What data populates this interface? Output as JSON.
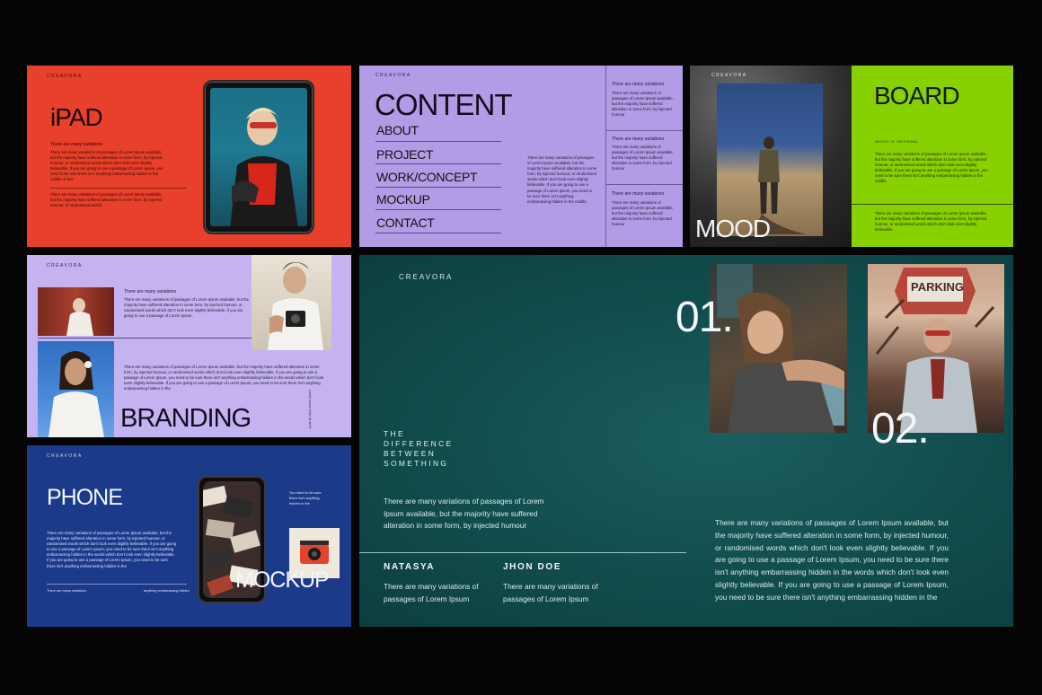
{
  "colors": {
    "orange": "#e8402a",
    "lavender": "#b39ce6",
    "lime": "#88d100",
    "navy": "#1c3a8a",
    "teal": "#0f4c4d",
    "dark_bg": "#050506"
  },
  "slide_ipad": {
    "brand": "CREAVORA",
    "title": "iPAD",
    "subhead": "There are many variations",
    "body1": "There are many variations of passages of Lorem Ipsum available, but the majority have suffered alteration in some form, by injected humour, or randomised words which don't look even slightly believable. If you are going to use a passage of Lorem Ipsum, you need to be sure there isn't anything embarrassing hidden in the middle of text.",
    "body2": "There are many variations of passages of Lorem Ipsum available, but the majority have suffered alteration in some form, by injected humour, or randomised words."
  },
  "slide_content": {
    "brand": "CREAVORA",
    "title": "CONTENT",
    "menu": [
      "ABOUT",
      "PROJECT",
      "WORK/CONCEPT",
      "MOCKUP",
      "CONTACT"
    ],
    "body": "There are many variations of passages of Lorem Ipsum available, but the majority have suffered alteration in some form, by injected humour, or randomised words which don't look even slightly believable. If you are going to use a passage of Lorem Ipsum, you need to be sure there isn't anything embarrassing hidden in the middle.",
    "col_heads": [
      "There are many variations",
      "There are many variations",
      "There are many variations"
    ],
    "col_body": "There are many variations of passages of Lorem Ipsum available, but the majority have suffered alteration in some form, by injected humour"
  },
  "slide_moodboard": {
    "brand": "CREAVORA",
    "title_left": "MOOD",
    "title_right": "BOARD",
    "subhead": "WHICH IS INFORMAL",
    "body1": "There are many variations of passages of Lorem Ipsum available, but the majority have suffered alteration in some form, by injected humour, or randomised words which don't look even slightly believable. If you are going to use a passage of Lorem Ipsum, you need to be sure there isn't anything embarrassing hidden in the middle.",
    "body2": "There are many variations of passages of Lorem Ipsum available, but the majority have suffered alteration in some form, by injected humour, or randomised words which don't look even slightly believable."
  },
  "slide_branding": {
    "brand": "CREAVORA",
    "title": "BRANDING",
    "subhead": "There are many variations",
    "body1": "There are many variations of passages of Lorem Ipsum available, but the majority have suffered alteration in some form, by injected humour, or randomised words which don't look even slightly believable. If you are going to use a passage of Lorem Ipsum.",
    "body2": "There are many variations of passages of Lorem Ipsum available, but the majority have suffered alteration in some form, by injected humour, or randomised words which don't look even slightly believable. If you are going to use a passage of Lorem Ipsum, you need to be sure there isn't anything embarrassing hidden in the words which don't look even slightly believable. If you are going to use a passage of Lorem Ipsum, you need to be sure there isn't anything embarrassing hidden in the",
    "side_text": "Lorem ipsum dolor sit amet"
  },
  "slide_phone": {
    "brand": "CREAVORA",
    "title": "PHONE",
    "title2": "MOCKUP",
    "side_note": "You need to be sure there isn't anything hidden in the",
    "body": "There are many variations of passages of Lorem Ipsum available, but the majority have suffered alteration in some form, by injected humour, or randomised words which don't look even slightly believable. If you are going to use a passage of Lorem Ipsum, you need to be sure there isn't anything embarrassing hidden in the words which don't look even slightly believable. If you are going to use a passage of Lorem Ipsum, you need to be sure there isn't anything embarrassing hidden in the",
    "footer_left": "There are many variations",
    "footer_right": "anything embarrassing hidden"
  },
  "slide_main": {
    "brand": "CREAVORA",
    "num1": "01.",
    "num2": "02.",
    "tagline_lines": [
      "THE",
      "DIFFERENCE",
      "BETWEEN",
      "SOMETHING"
    ],
    "intro": "There are many variations of passages of Lorem Ipsum available, but the majority have suffered alteration in some form, by injected humour",
    "person1_name": "NATASYA",
    "person1_text": "There are many variations of passages of Lorem Ipsum",
    "person2_name": "JHON DOE",
    "person2_text": "There are many variations of passages of Lorem Ipsum",
    "right_body": "There are many variations of passages of Lorem Ipsum available, but the majority have suffered alteration in some form, by injected humour, or randomised words which don't look even slightly believable. If you are going to use a passage of Lorem Ipsum, you need to be sure there isn't anything embarrassing hidden in the words which don't look even slightly believable. If you are going to use a passage of Lorem Ipsum, you need to be sure there isn't anything embarrassing hidden in the",
    "sign_text": "PARKING"
  }
}
